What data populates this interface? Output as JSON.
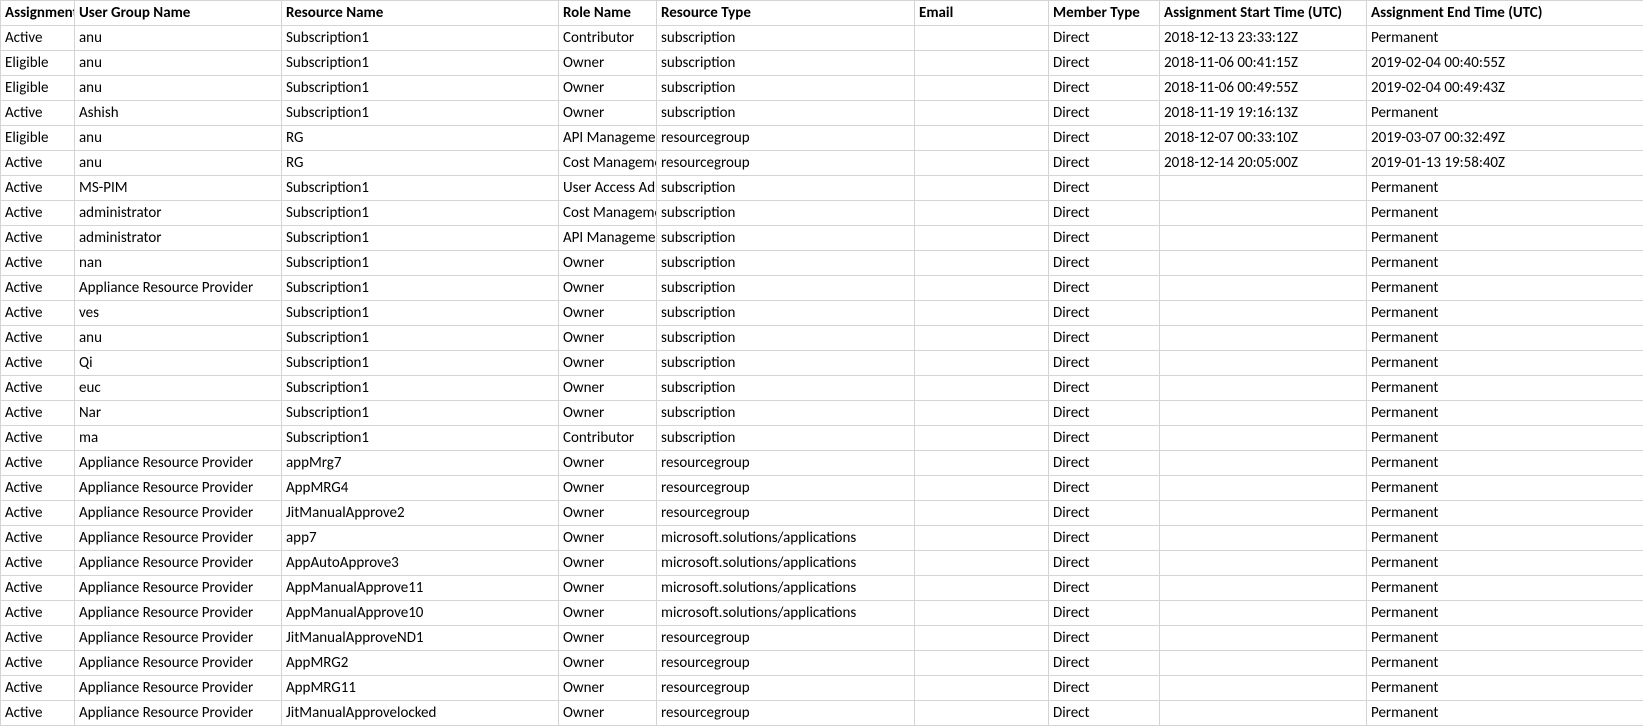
{
  "table": {
    "headers": [
      "Assignment",
      "User Group Name",
      "Resource Name",
      "Role Name",
      "Resource Type",
      "Email",
      "Member Type",
      "Assignment Start Time (UTC)",
      "Assignment End Time (UTC)"
    ],
    "rows": [
      [
        "Active",
        "anu",
        "Subscription1",
        "Contributor",
        "subscription",
        "",
        "Direct",
        "2018-12-13 23:33:12Z",
        "Permanent"
      ],
      [
        "Eligible",
        "anu",
        "Subscription1",
        "Owner",
        "subscription",
        "",
        "Direct",
        "2018-11-06 00:41:15Z",
        "2019-02-04 00:40:55Z"
      ],
      [
        "Eligible",
        "anu",
        "Subscription1",
        "Owner",
        "subscription",
        "",
        "Direct",
        "2018-11-06 00:49:55Z",
        "2019-02-04 00:49:43Z"
      ],
      [
        "Active",
        "Ashish",
        "Subscription1",
        "Owner",
        "subscription",
        "",
        "Direct",
        "2018-11-19 19:16:13Z",
        "Permanent"
      ],
      [
        "Eligible",
        "anu",
        "RG",
        "API Management",
        "resourcegroup",
        "",
        "Direct",
        "2018-12-07 00:33:10Z",
        "2019-03-07 00:32:49Z"
      ],
      [
        "Active",
        "anu",
        "RG",
        "Cost Management",
        "resourcegroup",
        "",
        "Direct",
        "2018-12-14 20:05:00Z",
        "2019-01-13 19:58:40Z"
      ],
      [
        "Active",
        "MS-PIM",
        "Subscription1",
        "User Access Administrator",
        "subscription",
        "",
        "Direct",
        "",
        "Permanent"
      ],
      [
        "Active",
        "administrator",
        "Subscription1",
        "Cost Management",
        "subscription",
        "",
        "Direct",
        "",
        "Permanent"
      ],
      [
        "Active",
        "administrator",
        "Subscription1",
        "API Management",
        "subscription",
        "",
        "Direct",
        "",
        "Permanent"
      ],
      [
        "Active",
        "nan",
        "Subscription1",
        "Owner",
        "subscription",
        "",
        "Direct",
        "",
        "Permanent"
      ],
      [
        "Active",
        "Appliance Resource Provider",
        "Subscription1",
        "Owner",
        "subscription",
        "",
        "Direct",
        "",
        "Permanent"
      ],
      [
        "Active",
        "ves",
        "Subscription1",
        "Owner",
        "subscription",
        "",
        "Direct",
        "",
        "Permanent"
      ],
      [
        "Active",
        "anu",
        "Subscription1",
        "Owner",
        "subscription",
        "",
        "Direct",
        "",
        "Permanent"
      ],
      [
        "Active",
        "Qi",
        "Subscription1",
        "Owner",
        "subscription",
        "",
        "Direct",
        "",
        "Permanent"
      ],
      [
        "Active",
        "euc",
        "Subscription1",
        "Owner",
        "subscription",
        "",
        "Direct",
        "",
        "Permanent"
      ],
      [
        "Active",
        "Nar",
        "Subscription1",
        "Owner",
        "subscription",
        "",
        "Direct",
        "",
        "Permanent"
      ],
      [
        "Active",
        "ma",
        "Subscription1",
        "Contributor",
        "subscription",
        "",
        "Direct",
        "",
        "Permanent"
      ],
      [
        "Active",
        "Appliance Resource Provider",
        "appMrg7",
        "Owner",
        "resourcegroup",
        "",
        "Direct",
        "",
        "Permanent"
      ],
      [
        "Active",
        "Appliance Resource Provider",
        "AppMRG4",
        "Owner",
        "resourcegroup",
        "",
        "Direct",
        "",
        "Permanent"
      ],
      [
        "Active",
        "Appliance Resource Provider",
        "JitManualApprove2",
        "Owner",
        "resourcegroup",
        "",
        "Direct",
        "",
        "Permanent"
      ],
      [
        "Active",
        "Appliance Resource Provider",
        "app7",
        "Owner",
        "microsoft.solutions/applications",
        "",
        "Direct",
        "",
        "Permanent"
      ],
      [
        "Active",
        "Appliance Resource Provider",
        "AppAutoApprove3",
        "Owner",
        "microsoft.solutions/applications",
        "",
        "Direct",
        "",
        "Permanent"
      ],
      [
        "Active",
        "Appliance Resource Provider",
        "AppManualApprove11",
        "Owner",
        "microsoft.solutions/applications",
        "",
        "Direct",
        "",
        "Permanent"
      ],
      [
        "Active",
        "Appliance Resource Provider",
        "AppManualApprove10",
        "Owner",
        "microsoft.solutions/applications",
        "",
        "Direct",
        "",
        "Permanent"
      ],
      [
        "Active",
        "Appliance Resource Provider",
        "JitManualApproveND1",
        "Owner",
        "resourcegroup",
        "",
        "Direct",
        "",
        "Permanent"
      ],
      [
        "Active",
        "Appliance Resource Provider",
        "AppMRG2",
        "Owner",
        "resourcegroup",
        "",
        "Direct",
        "",
        "Permanent"
      ],
      [
        "Active",
        "Appliance Resource Provider",
        "AppMRG11",
        "Owner",
        "resourcegroup",
        "",
        "Direct",
        "",
        "Permanent"
      ],
      [
        "Active",
        "Appliance Resource Provider",
        "JitManualApprovelocked",
        "Owner",
        "resourcegroup",
        "",
        "Direct",
        "",
        "Permanent"
      ]
    ]
  }
}
